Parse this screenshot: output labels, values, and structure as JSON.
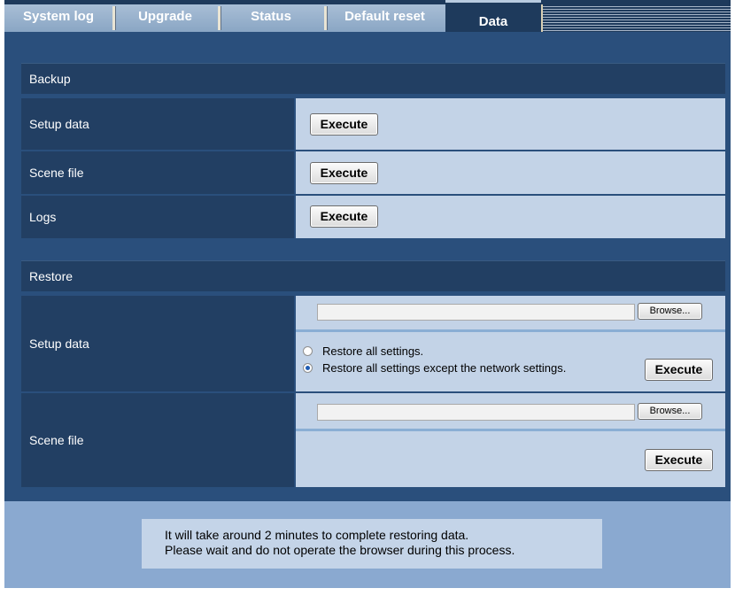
{
  "tabs": [
    {
      "label": "System log"
    },
    {
      "label": "Upgrade"
    },
    {
      "label": "Status"
    },
    {
      "label": "Default reset"
    },
    {
      "label": "Data",
      "active": true
    }
  ],
  "backup": {
    "title": "Backup",
    "rows": [
      {
        "label": "Setup data",
        "button": "Execute"
      },
      {
        "label": "Scene file",
        "button": "Execute"
      },
      {
        "label": "Logs",
        "button": "Execute"
      }
    ]
  },
  "restore": {
    "title": "Restore",
    "setup_data": {
      "label": "Setup data",
      "file_value": "",
      "browse_label": "Browse...",
      "options": [
        {
          "label": "Restore all settings.",
          "checked": false
        },
        {
          "label": "Restore all settings except the network settings.",
          "checked": true
        }
      ],
      "execute_label": "Execute"
    },
    "scene_file": {
      "label": "Scene file",
      "file_value": "",
      "browse_label": "Browse...",
      "execute_label": "Execute"
    }
  },
  "notice": {
    "line1": "It will take around 2 minutes to complete restoring data.",
    "line2": "Please wait and do not operate the browser during this process."
  },
  "colors": {
    "frame": "#1e3a5c",
    "content_bg": "#2a4f7c",
    "label_bg": "#223f63",
    "value_bg": "#c3d3e7",
    "notice_panel": "#8aa9d0",
    "tab_inactive": "#99b2cd"
  }
}
